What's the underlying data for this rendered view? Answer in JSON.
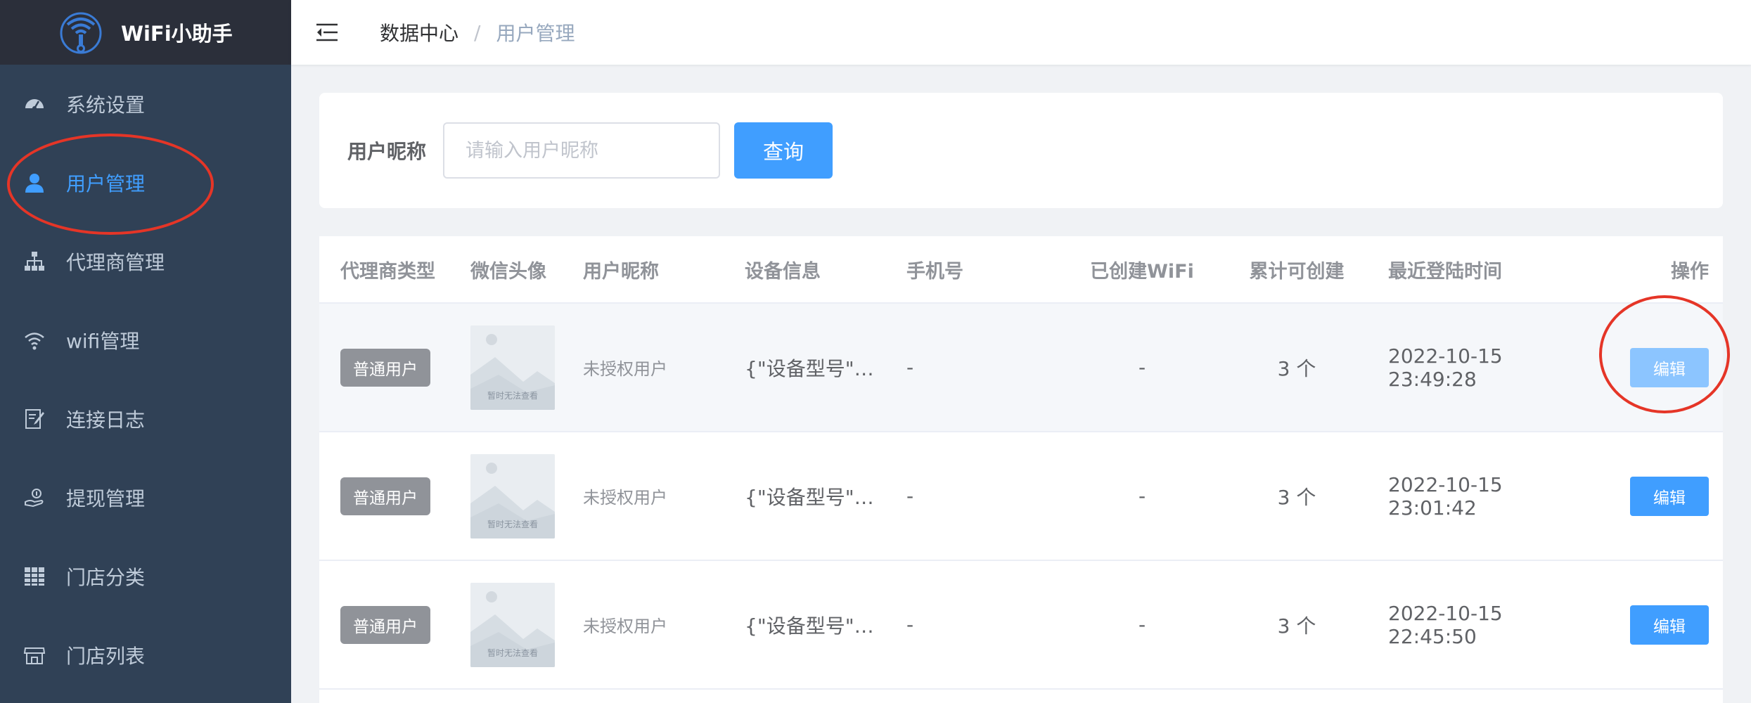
{
  "brand": {
    "title": "WiFi小助手",
    "logo_icon": "wifi-logo-icon"
  },
  "sidebar": {
    "items": [
      {
        "label": "系统设置",
        "icon": "dashboard-icon",
        "active": false
      },
      {
        "label": "用户管理",
        "icon": "user-icon",
        "active": true
      },
      {
        "label": "代理商管理",
        "icon": "org-tree-icon",
        "active": false
      },
      {
        "label": "wifi管理",
        "icon": "wifi-icon",
        "active": false
      },
      {
        "label": "连接日志",
        "icon": "log-icon",
        "active": false
      },
      {
        "label": "提现管理",
        "icon": "withdraw-icon",
        "active": false
      },
      {
        "label": "门店分类",
        "icon": "grid-icon",
        "active": false
      },
      {
        "label": "门店列表",
        "icon": "store-icon",
        "active": false
      }
    ]
  },
  "header": {
    "breadcrumb": [
      "数据中心",
      "用户管理"
    ],
    "separator": "/"
  },
  "search": {
    "label": "用户昵称",
    "placeholder": "请输入用户昵称",
    "value": "",
    "button": "查询"
  },
  "table": {
    "columns": [
      "代理商类型",
      "微信头像",
      "用户昵称",
      "设备信息",
      "手机号",
      "已创建WiFi",
      "累计可创建",
      "最近登陆时间",
      "操作"
    ],
    "rows": [
      {
        "type": "普通用户",
        "avatar_text": "暂时无法查看",
        "nickname": "未授权用户",
        "device": "{\"设备型号\":...",
        "phone": "-",
        "created": "-",
        "total": "3 个",
        "last_login": "2022-10-15 23:49:28",
        "action": "编辑"
      },
      {
        "type": "普通用户",
        "avatar_text": "暂时无法查看",
        "nickname": "未授权用户",
        "device": "{\"设备型号\":...",
        "phone": "-",
        "created": "-",
        "total": "3 个",
        "last_login": "2022-10-15 23:01:42",
        "action": "编辑"
      },
      {
        "type": "普通用户",
        "avatar_text": "暂时无法查看",
        "nickname": "未授权用户",
        "device": "{\"设备型号\":...",
        "phone": "-",
        "created": "-",
        "total": "3 个",
        "last_login": "2022-10-15 22:45:50",
        "action": "编辑"
      }
    ]
  },
  "colors": {
    "sidebar_bg": "#304156",
    "brand_bg": "#2b2f3a",
    "accent": "#409eff",
    "annotation_red": "#e53527"
  }
}
